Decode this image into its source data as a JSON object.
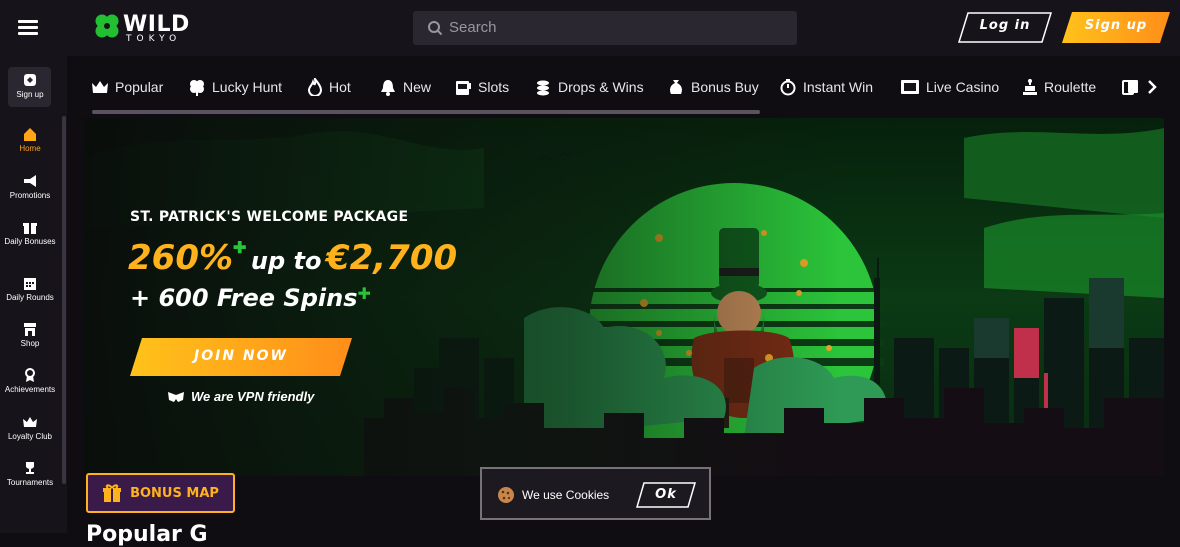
{
  "brand": {
    "name": "WILD",
    "sub": "TOKYO"
  },
  "header": {
    "search_placeholder": "Search",
    "login_label": "Log in",
    "signup_label": "Sign up"
  },
  "sidebar": {
    "items": [
      {
        "label": "Sign up",
        "icon": "signup-icon"
      },
      {
        "label": "Home",
        "icon": "home-icon",
        "active": true
      },
      {
        "label": "Promotions",
        "icon": "megaphone-icon"
      },
      {
        "label": "Daily Bonuses",
        "icon": "gift-icon"
      },
      {
        "label": "Daily Rounds",
        "icon": "calendar-icon"
      },
      {
        "label": "Shop",
        "icon": "shop-icon"
      },
      {
        "label": "Achievements",
        "icon": "medal-icon"
      },
      {
        "label": "Loyalty Club",
        "icon": "crown-icon"
      },
      {
        "label": "Tournaments",
        "icon": "trophy-icon"
      }
    ]
  },
  "categories": [
    {
      "label": "Popular",
      "icon": "crown-icon"
    },
    {
      "label": "Lucky Hunt",
      "icon": "clover-icon"
    },
    {
      "label": "Hot",
      "icon": "flame-icon"
    },
    {
      "label": "New",
      "icon": "bell-icon"
    },
    {
      "label": "Slots",
      "icon": "slot-machine-icon"
    },
    {
      "label": "Drops & Wins",
      "icon": "coins-icon"
    },
    {
      "label": "Bonus Buy",
      "icon": "money-bag-icon"
    },
    {
      "label": "Instant Win",
      "icon": "stopwatch-icon"
    },
    {
      "label": "Live Casino",
      "icon": "live-icon"
    },
    {
      "label": "Roulette",
      "icon": "roulette-icon"
    }
  ],
  "hero": {
    "eyebrow": "ST. PATRICK'S WELCOME PACKAGE",
    "percent": "260%",
    "up_to": "up to",
    "amount": "€2,700",
    "free_spins": "+ 600 Free Spins",
    "cta": "JOIN NOW",
    "vpn_note": "We are VPN friendly"
  },
  "bonus_map_label": "BONUS MAP",
  "cookie": {
    "text": "We use Cookies",
    "ok_label": "Ok"
  },
  "section_heading": "Popular G",
  "colors": {
    "accent": "#ffa517",
    "bg": "#0f0c12",
    "panel": "#17131b",
    "green": "#29c43a"
  }
}
